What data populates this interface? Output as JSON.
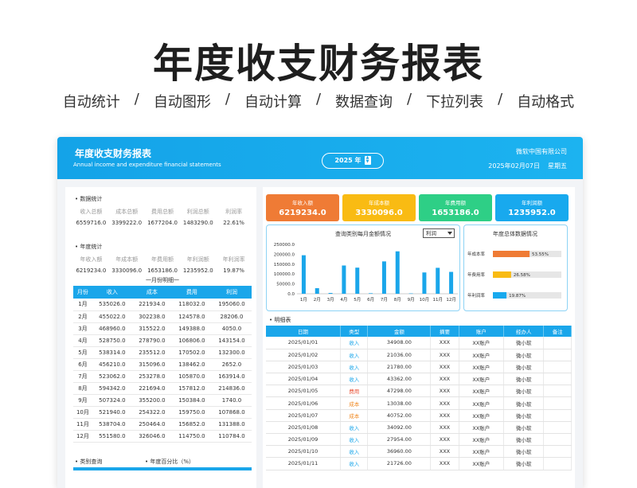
{
  "hero": {
    "title": "年度收支财务报表",
    "features": [
      "自动统计",
      "自动图形",
      "自动计算",
      "数据查询",
      "下拉列表",
      "自动格式"
    ],
    "separator": "/"
  },
  "header": {
    "title": "年度收支财务报表",
    "subtitle": "Annual income and expenditure financial statements",
    "year": "2025 年",
    "company": "微软中国有限公司",
    "date": "2025年02月07日",
    "weekday": "星期五"
  },
  "data_stats": {
    "title": "数据统计",
    "labels": [
      "收入总额",
      "成本总额",
      "费用总额",
      "利润总额",
      "利润率"
    ],
    "values": [
      "6559716.0",
      "3399222.0",
      "1677204.0",
      "1483290.0",
      "22.61%"
    ]
  },
  "year_stats": {
    "title": "年度统计",
    "labels": [
      "年收入额",
      "年成本额",
      "年费用额",
      "年利润额",
      "年利润率"
    ],
    "values": [
      "6219234.0",
      "3330096.0",
      "1653186.0",
      "1235952.0",
      "19.87%"
    ]
  },
  "monthly": {
    "caption": "一月份明细一",
    "headers": [
      "月份",
      "收入",
      "成本",
      "费用",
      "利润"
    ],
    "rows": [
      [
        "1月",
        "535026.0",
        "221934.0",
        "118032.0",
        "195060.0"
      ],
      [
        "2月",
        "455022.0",
        "302238.0",
        "124578.0",
        "28206.0"
      ],
      [
        "3月",
        "468960.0",
        "315522.0",
        "149388.0",
        "4050.0"
      ],
      [
        "4月",
        "528750.0",
        "278790.0",
        "106806.0",
        "143154.0"
      ],
      [
        "5月",
        "538314.0",
        "235512.0",
        "170502.0",
        "132300.0"
      ],
      [
        "6月",
        "456210.0",
        "315096.0",
        "138462.0",
        "2652.0"
      ],
      [
        "7月",
        "523062.0",
        "253278.0",
        "105870.0",
        "163914.0"
      ],
      [
        "8月",
        "594342.0",
        "221694.0",
        "157812.0",
        "214836.0"
      ],
      [
        "9月",
        "507324.0",
        "355200.0",
        "150384.0",
        "1740.0"
      ],
      [
        "10月",
        "521940.0",
        "254322.0",
        "159750.0",
        "107868.0"
      ],
      [
        "11月",
        "538704.0",
        "250464.0",
        "156852.0",
        "131388.0"
      ],
      [
        "12月",
        "551580.0",
        "326046.0",
        "114750.0",
        "110784.0"
      ]
    ]
  },
  "bottom": {
    "category_query": "类别查询",
    "year_percent": "年度百分比（%）"
  },
  "kpis": [
    {
      "label": "年收入额",
      "value": "6219234.0",
      "color": "#ef7b35"
    },
    {
      "label": "年成本额",
      "value": "3330096.0",
      "color": "#f9bb13"
    },
    {
      "label": "年费用额",
      "value": "1653186.0",
      "color": "#2ecf86"
    },
    {
      "label": "年利润额",
      "value": "1235952.0",
      "color": "#18a9ee"
    }
  ],
  "chart_data": [
    {
      "type": "bar",
      "title": "查询类别每月金额情况",
      "categories": [
        "1月",
        "2月",
        "3月",
        "4月",
        "5月",
        "6月",
        "7月",
        "8月",
        "9月",
        "10月",
        "11月",
        "12月"
      ],
      "values": [
        195060,
        28206,
        4050,
        143154,
        132300,
        2652,
        163914,
        214836,
        1740,
        107868,
        131388,
        110784
      ],
      "ylim": [
        0,
        250000
      ],
      "yticks": [
        "0.0",
        "50000.0",
        "100000.0",
        "150000.0",
        "200000.0",
        "250000.0"
      ],
      "color": "#1aa6ea",
      "dropdown_value": "利润"
    },
    {
      "type": "bar",
      "title": "年度总体数据情况",
      "categories": [
        "年成本率",
        "年费用率",
        "年利润率"
      ],
      "values": [
        53.55,
        26.58,
        19.87
      ],
      "labels": [
        "53.55%",
        "26.58%",
        "19.87%"
      ],
      "colors": [
        "#ef7b35",
        "#f9bb13",
        "#18a9ee"
      ],
      "xlim": [
        0,
        100
      ]
    }
  ],
  "detail": {
    "title": "明细表",
    "headers": [
      "日期",
      "类型",
      "金额",
      "摘要",
      "账户",
      "经办人",
      "备注"
    ],
    "rows": [
      [
        "2025/01/01",
        "收入",
        "34908.00",
        "XXX",
        "XX账户",
        "微小软",
        ""
      ],
      [
        "2025/01/02",
        "收入",
        "21036.00",
        "XXX",
        "XX账户",
        "微小软",
        ""
      ],
      [
        "2025/01/03",
        "收入",
        "21780.00",
        "XXX",
        "XX账户",
        "微小软",
        ""
      ],
      [
        "2025/01/04",
        "收入",
        "43362.00",
        "XXX",
        "XX账户",
        "微小软",
        ""
      ],
      [
        "2025/01/05",
        "费用",
        "47298.00",
        "XXX",
        "XX账户",
        "微小软",
        ""
      ],
      [
        "2025/01/06",
        "成本",
        "13038.00",
        "XXX",
        "XX账户",
        "微小软",
        ""
      ],
      [
        "2025/01/07",
        "成本",
        "40752.00",
        "XXX",
        "XX账户",
        "微小软",
        ""
      ],
      [
        "2025/01/08",
        "收入",
        "34092.00",
        "XXX",
        "XX账户",
        "微小软",
        ""
      ],
      [
        "2025/01/09",
        "收入",
        "27954.00",
        "XXX",
        "XX账户",
        "微小软",
        ""
      ],
      [
        "2025/01/10",
        "收入",
        "36960.00",
        "XXX",
        "XX账户",
        "微小软",
        ""
      ],
      [
        "2025/01/11",
        "收入",
        "21726.00",
        "XXX",
        "XX账户",
        "微小软",
        ""
      ]
    ]
  }
}
